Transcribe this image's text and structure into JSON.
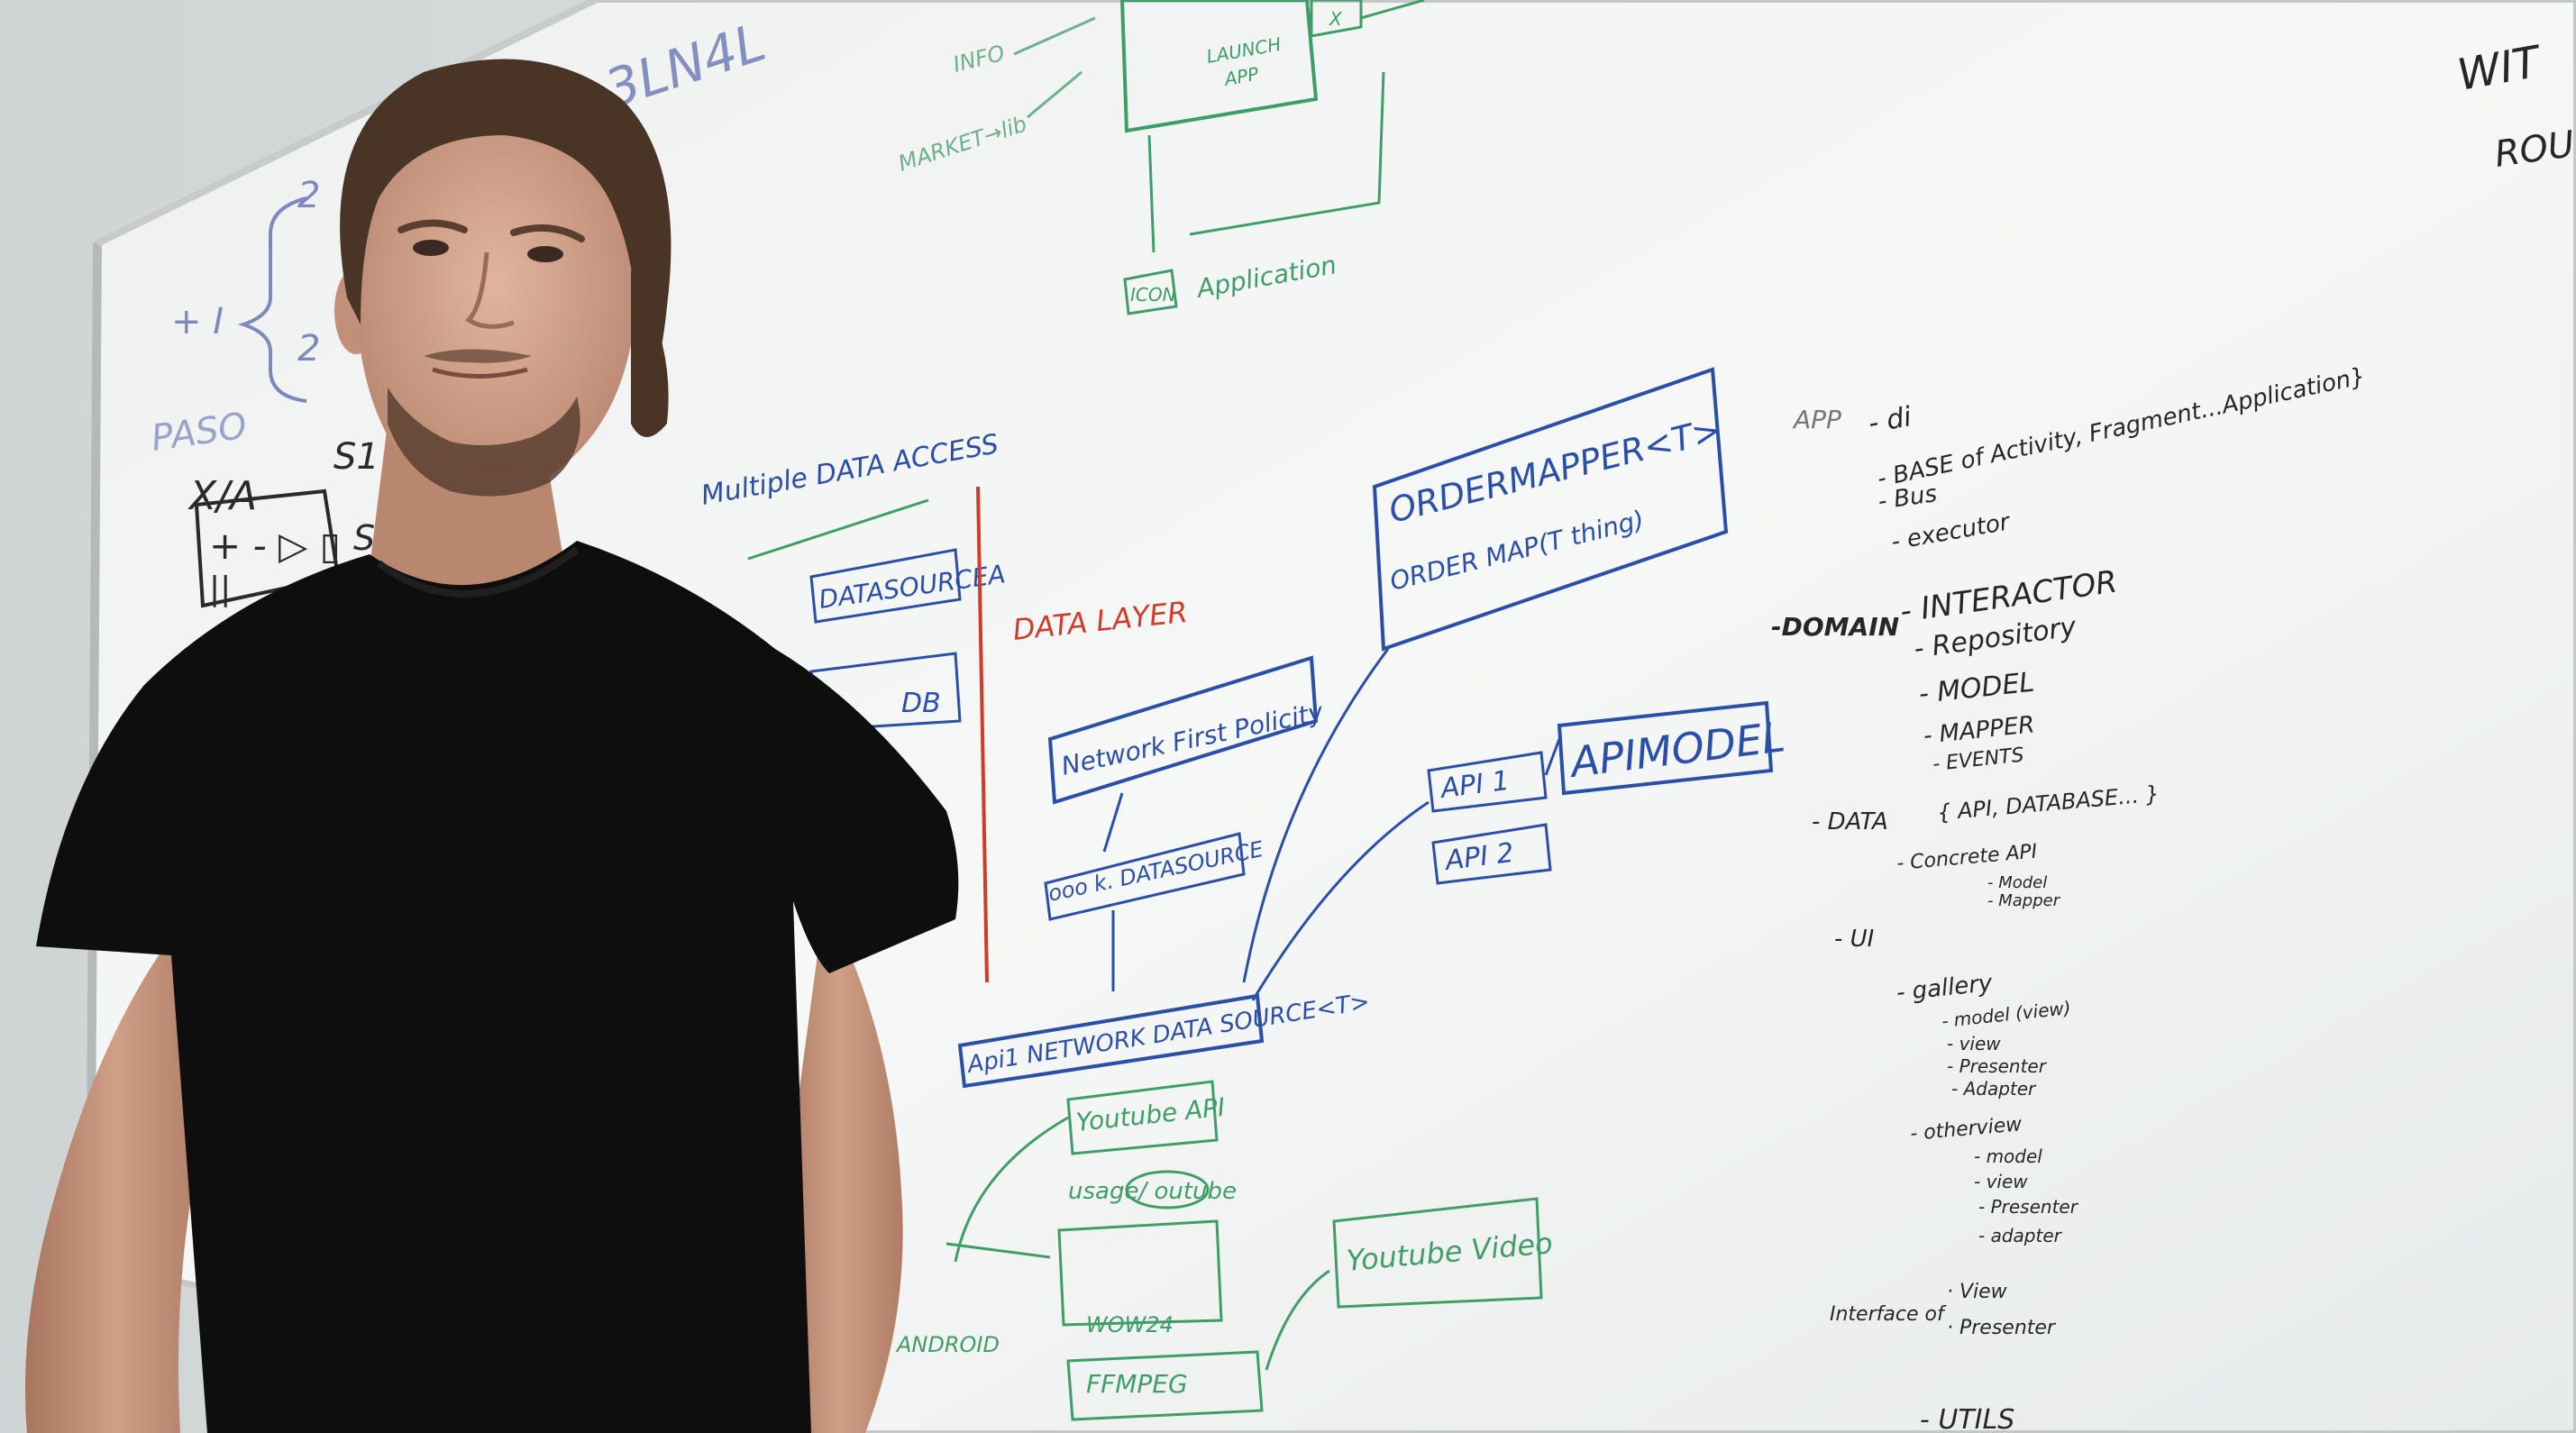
{
  "scene": {
    "description_colors": {
      "wall": "#e4e8e8",
      "board": "#f4f6f5",
      "frame": "#c9cccb",
      "blue_marker": "#1f3f9a",
      "green_marker": "#2f9a5c",
      "red_marker": "#d23a2a",
      "black_marker": "#2a2a2a",
      "shirt": "#0d0d0d",
      "skin": "#d2a48b",
      "hair": "#4a3426"
    }
  },
  "board": {
    "top_left": {
      "top_scrawl": "3LN4L",
      "brace_top": "2",
      "brace_left": "+ I",
      "brace_bottom": "2",
      "paso": "PASO",
      "xa": "X/A",
      "s1": "S1",
      "s6": "S6",
      "box_symbols": "+ - ▷ ▯",
      "box_pause": "||"
    },
    "top_green": {
      "info": "INFO",
      "market_lib": "MARKET→lib",
      "launch_app_line1": "LAUNCH",
      "launch_app_line2": "APP",
      "x_mark": "X",
      "icon": "ICON",
      "application": "Application"
    },
    "middle": {
      "multiple_data_access": "Multiple DATA ACCESS",
      "datasource_a": "DATASOURCEA",
      "datasource_b": "DB",
      "data_layer": "DATA LAYER",
      "network_first_policy": "Network First Policity",
      "network_datasource": "ooo k. DATASOURCE",
      "api1_network_datasource": "Api1 NETWORK DATA SOURCE<T>",
      "order_mapper_line1": "ORDERMAPPER<T>",
      "order_mapper_line2": "ORDER MAP(T thing)",
      "api1": "API 1",
      "api2": "API 2",
      "api_model": "APIMODEL"
    },
    "bottom_green": {
      "youtube_api": "Youtube API",
      "usage_dash": "usage/ outube",
      "wow24": "WOW24",
      "android": "ANDROID",
      "ffmpeg": "FFMPEG",
      "youtube_video": "Youtube Video"
    },
    "right_list": {
      "top_right_1": "WIT",
      "top_right_2": "ROU",
      "app": "APP",
      "di": "- di",
      "base": "- BASE of Activity, Fragment...Application}",
      "bus": "- Bus",
      "executor": "- executor",
      "domain": "-DOMAIN",
      "interactor": "- INTERACTOR",
      "repository": "- Repository",
      "model": "- MODEL",
      "mapper": "- MAPPER",
      "events": "- EVENTS",
      "data": "- DATA",
      "data_braces": "{ API, DATABASE... }",
      "concrete_api": "- Concrete API",
      "concrete_model": "- Model",
      "concrete_mapper": "- Mapper",
      "ui": "- UI",
      "gallery": "- gallery",
      "gallery_model": "- model (view)",
      "gallery_view": "- view",
      "gallery_presenter": "- Presenter",
      "gallery_adapter": "- Adapter",
      "otherview": "- otherview",
      "otherview_model": "- model",
      "otherview_view": "- view",
      "otherview_presenter": "- Presenter",
      "otherview_adapter": "- adapter",
      "interface": "Interface of",
      "iface_view": "· View",
      "iface_presenter": "· Presenter",
      "utils": "- UTILS"
    }
  }
}
